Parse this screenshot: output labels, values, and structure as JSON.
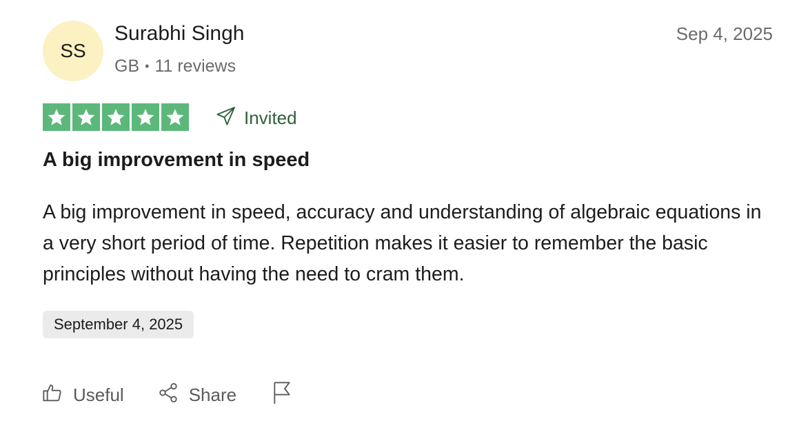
{
  "reviewer": {
    "initials": "SS",
    "name": "Surabhi Singh",
    "country": "GB",
    "separator": "•",
    "review_count": "11 reviews"
  },
  "review": {
    "date_posted": "Sep 4, 2025",
    "rating": 5,
    "rating_max": 5,
    "star_color": "#5bb87a",
    "invited_label": "Invited",
    "title": "A big improvement in speed",
    "body": "A big improvement in speed, accuracy and understanding of algebraic equations in a very short period of time. Repetition makes it easier to remember the basic principles without having the need to cram them.",
    "date_of_experience": "September 4, 2025"
  },
  "actions": {
    "useful_label": "Useful",
    "share_label": "Share",
    "useful_icon": "thumbs-up-icon",
    "share_icon": "share-icon",
    "report_icon": "flag-icon"
  }
}
